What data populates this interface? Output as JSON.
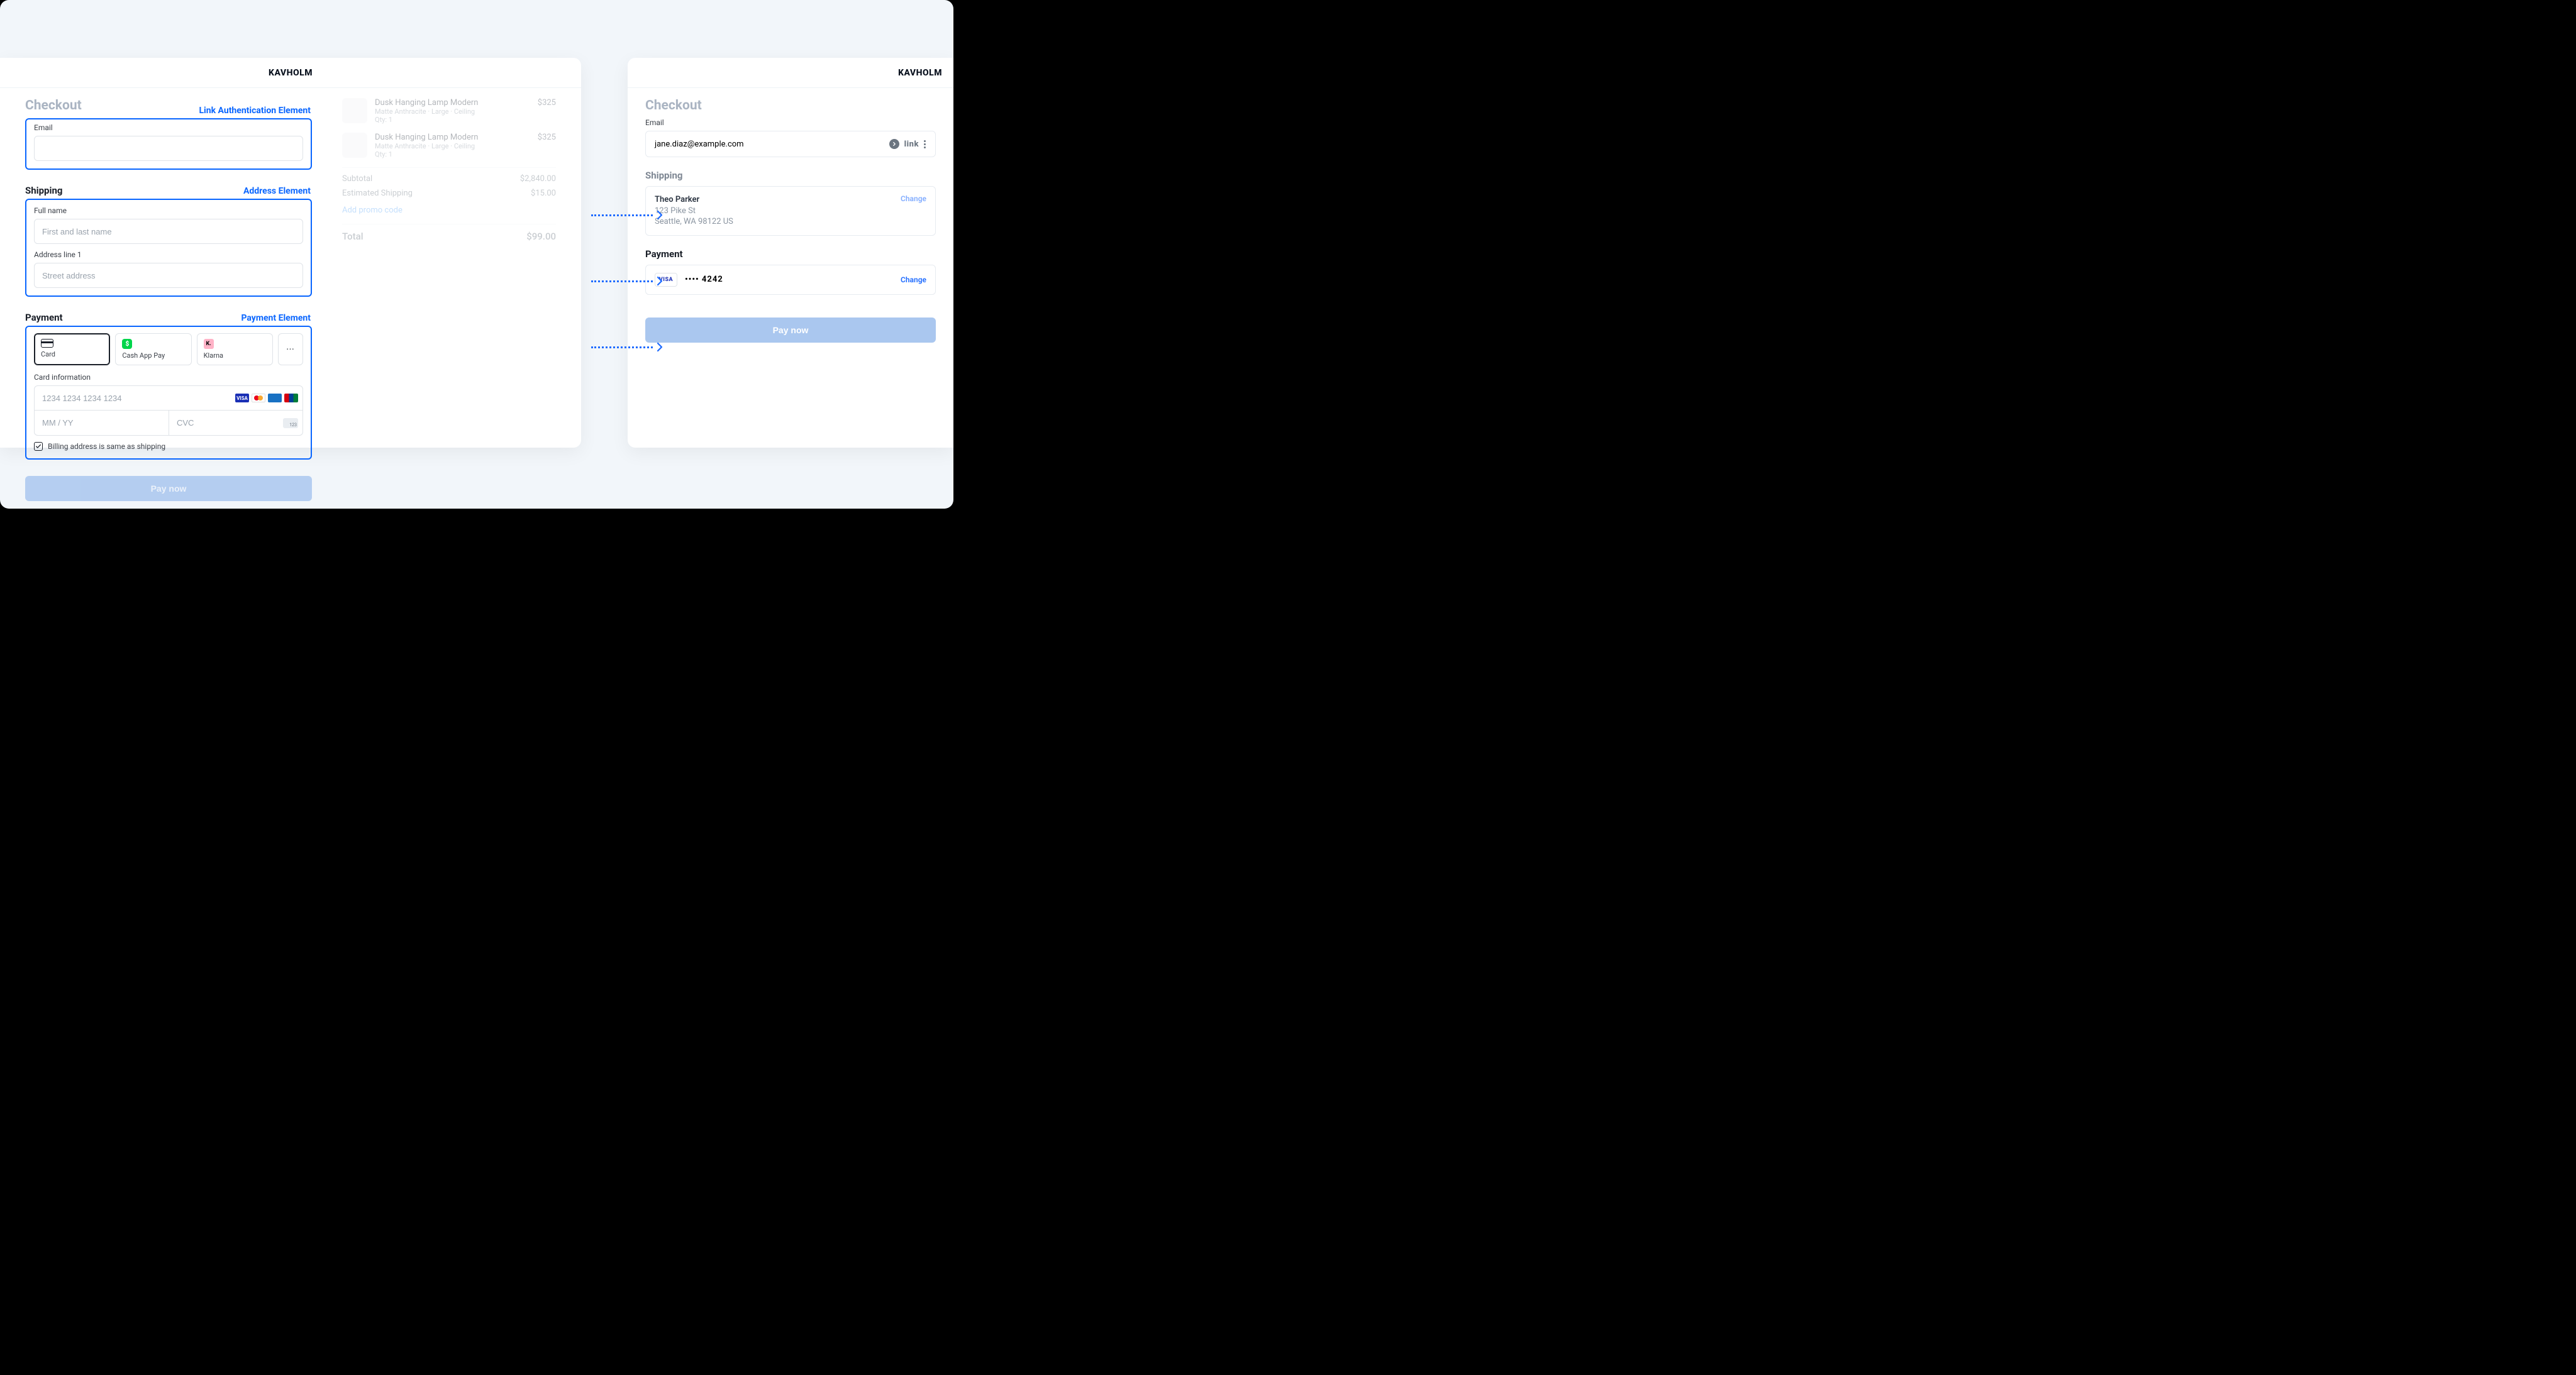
{
  "brand": "KAVHOLM",
  "left": {
    "checkout_title": "Checkout",
    "annotations": {
      "link_auth": "Link Authentication Element",
      "address": "Address Element",
      "payment": "Payment Element"
    },
    "email": {
      "label": "Email"
    },
    "shipping": {
      "heading": "Shipping",
      "full_name_label": "Full name",
      "full_name_placeholder": "First and last name",
      "addr1_label": "Address line 1",
      "addr1_placeholder": "Street address"
    },
    "payment": {
      "heading": "Payment",
      "tabs": {
        "card": "Card",
        "cashapp": "Cash App Pay",
        "klarna": "Klarna",
        "more": "···"
      },
      "card_info_label": "Card information",
      "card_number_placeholder": "1234 1234 1234 1234",
      "exp_placeholder": "MM / YY",
      "cvc_placeholder": "CVC",
      "billing_same": "Billing address is same as shipping"
    },
    "paynow": "Pay now",
    "summary": {
      "items": [
        {
          "title": "Dusk Hanging Lamp Modern",
          "sub": "Matte Anthracite · Large · Ceiling",
          "qty": "Qty: 1",
          "price": "$325"
        },
        {
          "title": "Dusk Hanging Lamp Modern",
          "sub": "Matte Anthracite · Large · Ceiling",
          "qty": "Qty: 1",
          "price": "$325"
        }
      ],
      "subtotal_label": "Subtotal",
      "subtotal_value": "$2,840.00",
      "shipping_label": "Estimated Shipping",
      "shipping_value": "$15.00",
      "promo": "Add promo code",
      "total_label": "Total",
      "total_value": "$99.00"
    }
  },
  "right": {
    "checkout_title": "Checkout",
    "email_label": "Email",
    "email_value": "jane.diaz@example.com",
    "link_label": "link",
    "shipping_heading": "Shipping",
    "ship_name": "Theo Parker",
    "ship_line1": "123 Pike St",
    "ship_line2": "Seattle, WA 98122 US",
    "change": "Change",
    "payment_heading": "Payment",
    "visa_label": "VISA",
    "masked_card": "•••• 4242",
    "paynow": "Pay now"
  }
}
